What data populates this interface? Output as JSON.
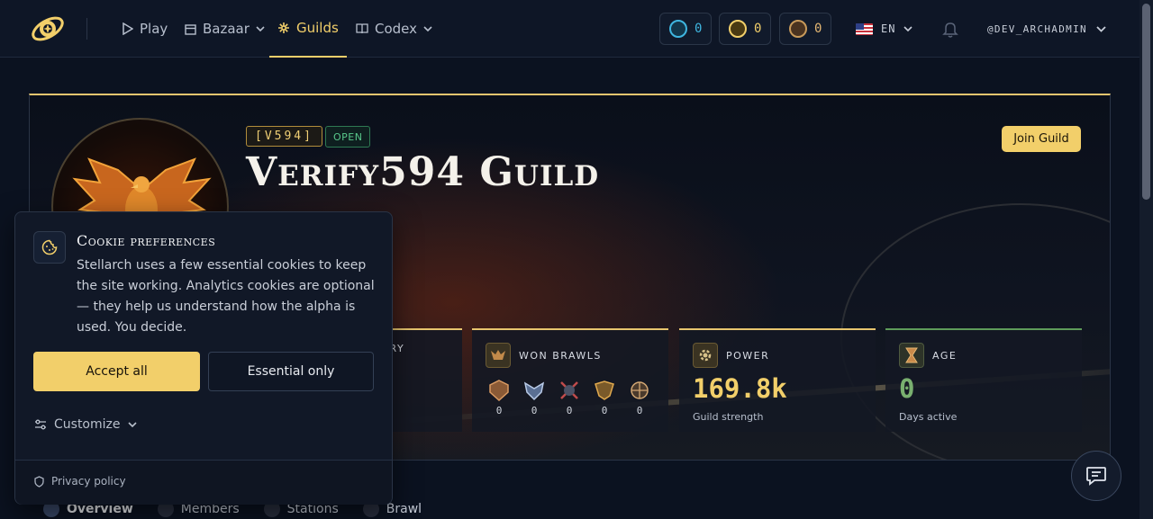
{
  "nav": {
    "items": [
      {
        "label": "Play",
        "icon": "play-icon"
      },
      {
        "label": "Bazaar",
        "icon": "store-icon"
      },
      {
        "label": "Guilds",
        "icon": "guilds-icon",
        "active": true
      },
      {
        "label": "Codex",
        "icon": "book-icon"
      }
    ],
    "currencies": [
      {
        "name": "crystal",
        "value": "0",
        "color": "#3fb6e0"
      },
      {
        "name": "gold",
        "value": "0",
        "color": "#f2cf6a"
      },
      {
        "name": "bronze",
        "value": "0",
        "color": "#e6b873"
      }
    ],
    "language": "EN",
    "username": "@DEV_ARCHADMIN"
  },
  "guild": {
    "tag": "[V594]",
    "status": "OPEN",
    "name": "Verify594 Guild",
    "join_label": "Join Guild",
    "stats": {
      "treasury_label_visible": "URY",
      "won_brawls": {
        "label": "WON BRAWLS",
        "counts": [
          "0",
          "0",
          "0",
          "0",
          "0"
        ]
      },
      "power": {
        "label": "POWER",
        "value": "169.8k",
        "sub": "Guild strength"
      },
      "age": {
        "label": "AGE",
        "value": "0",
        "sub": "Days active"
      }
    }
  },
  "tabs": [
    {
      "label": "Overview",
      "active": true
    },
    {
      "label": "Members"
    },
    {
      "label": "Stations"
    },
    {
      "label": "Brawl"
    }
  ],
  "cookie": {
    "title": "Cookie preferences",
    "body": "Stellarch uses a few essential cookies to keep the site working. Analytics cookies are optional — they help us understand how the alpha is used. You decide.",
    "accept_label": "Accept all",
    "essential_label": "Essential only",
    "customize_label": "Customize",
    "privacy_label": "Privacy policy"
  },
  "colors": {
    "accent": "#f2cf6a",
    "open_green": "#58c78a",
    "age_green": "#79b06f",
    "background": "#0b1220"
  }
}
